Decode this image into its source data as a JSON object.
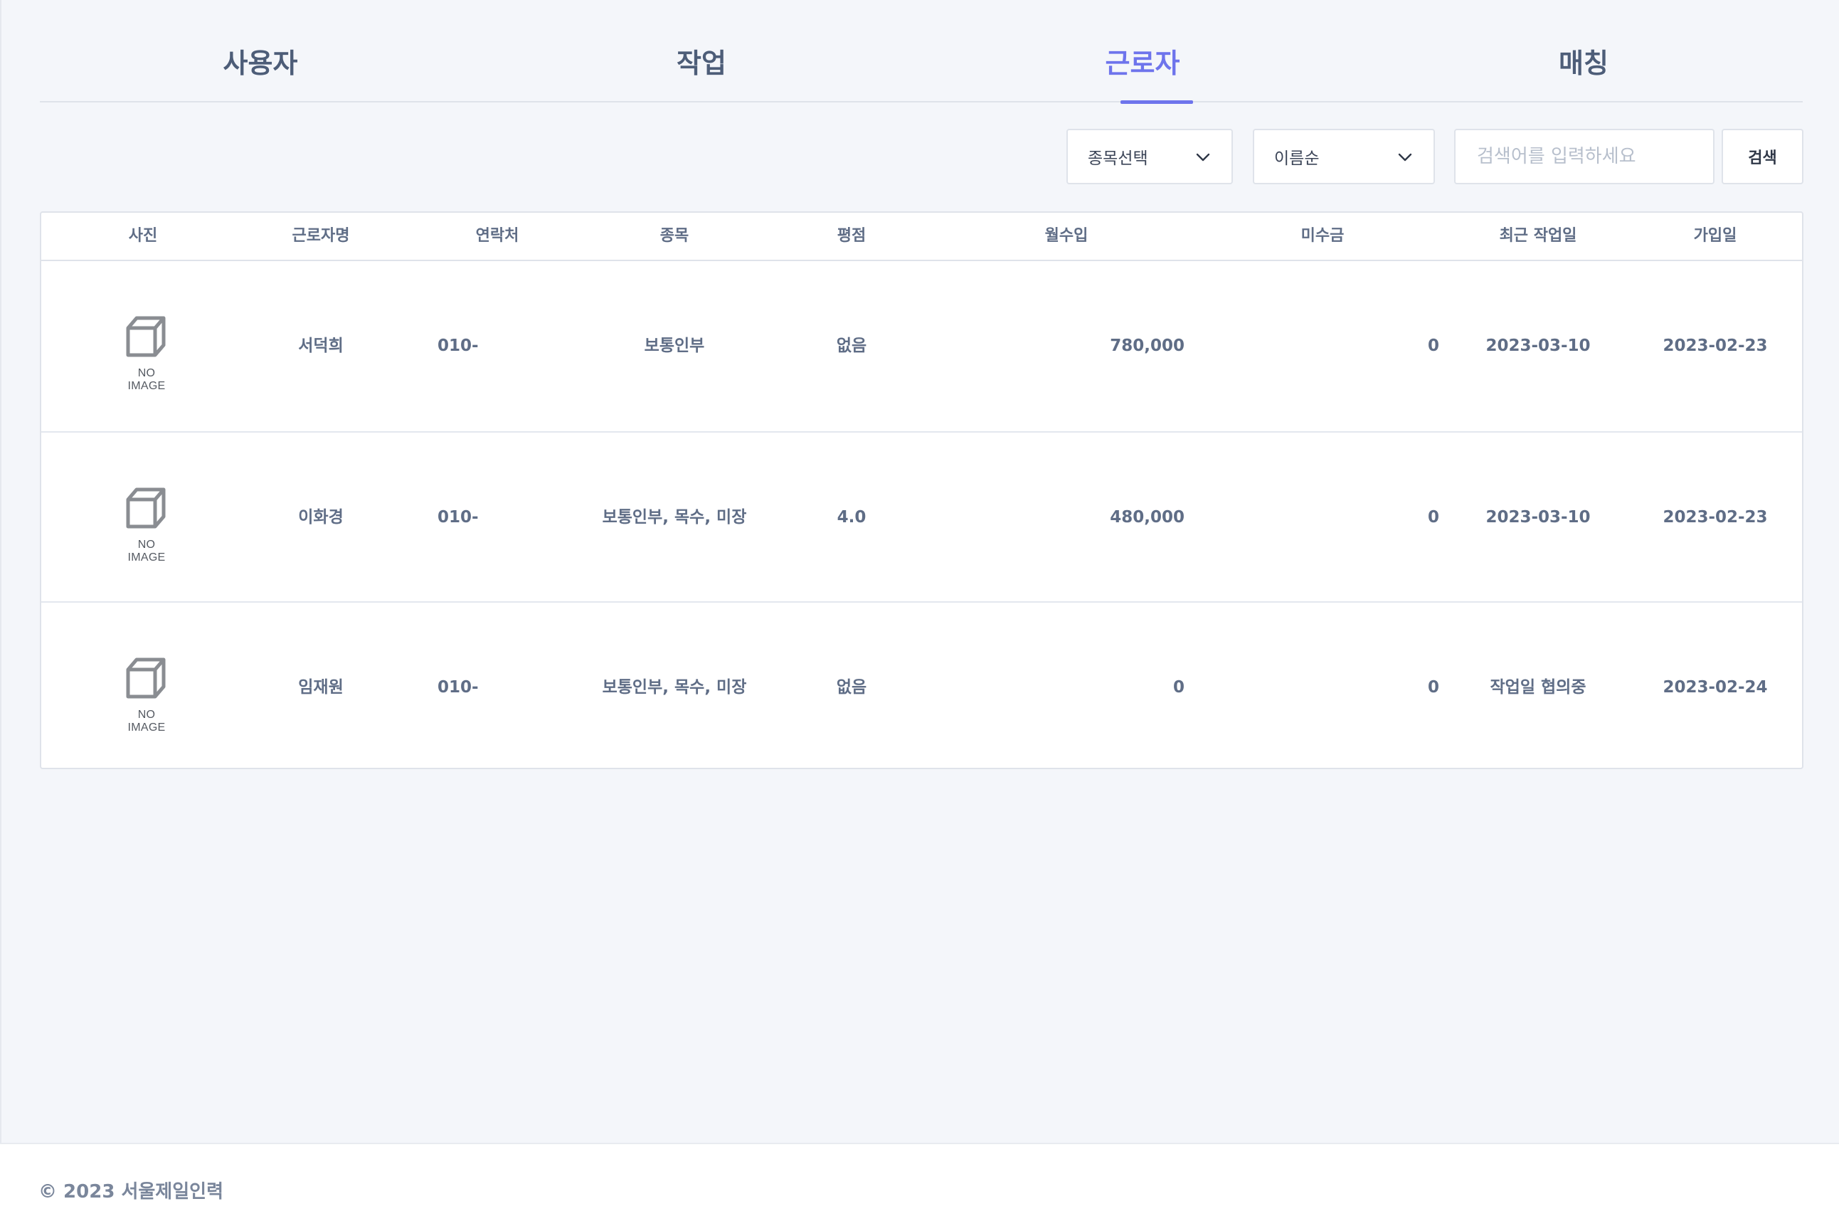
{
  "tabs": [
    {
      "label": "사용자",
      "active": false
    },
    {
      "label": "작업",
      "active": false
    },
    {
      "label": "근로자",
      "active": true
    },
    {
      "label": "매칭",
      "active": false
    }
  ],
  "toolbar": {
    "category_select": "종목선택",
    "sort_select": "이름순",
    "search_placeholder": "검색어를 입력하세요",
    "search_button": "검색"
  },
  "table": {
    "headers": [
      "사진",
      "근로자명",
      "연락처",
      "종목",
      "평점",
      "월수입",
      "미수금",
      "최근 작업일",
      "가입일"
    ],
    "rows": [
      {
        "photo": "NO IMAGE",
        "name": "서덕희",
        "phone": "010-",
        "category": "보통인부",
        "rating": "없음",
        "monthly_income": "780,000",
        "unpaid": "0",
        "recent_work": "2023-03-10",
        "joined": "2023-02-23"
      },
      {
        "photo": "NO IMAGE",
        "name": "이화경",
        "phone": "010-",
        "category": "보통인부, 목수, 미장",
        "rating": "4.0",
        "monthly_income": "480,000",
        "unpaid": "0",
        "recent_work": "2023-03-10",
        "joined": "2023-02-23"
      },
      {
        "photo": "NO IMAGE",
        "name": "임재원",
        "phone": "010-",
        "category": "보통인부, 목수, 미장",
        "rating": "없음",
        "monthly_income": "0",
        "unpaid": "0",
        "recent_work": "작업일 협의중",
        "joined": "2023-02-24"
      }
    ]
  },
  "footer": {
    "copyright": "© 2023 서울제일인력"
  },
  "colors": {
    "accent": "#6e74ec",
    "text": "#5f6d86",
    "background": "#f4f6fa"
  }
}
